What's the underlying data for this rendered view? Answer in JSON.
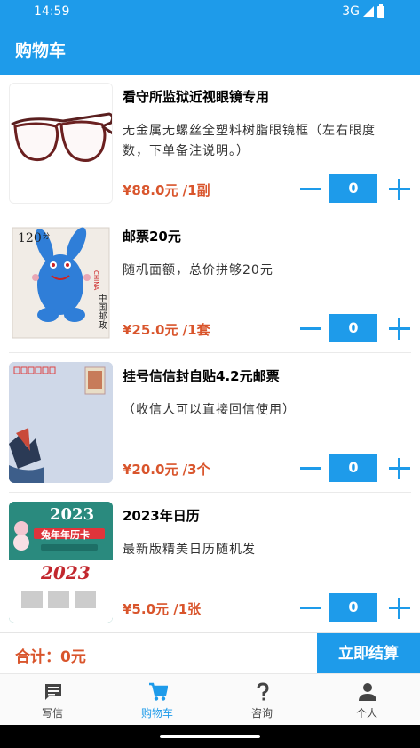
{
  "status_bar": {
    "time": "14:59",
    "network": "3G"
  },
  "app_bar": {
    "title": "购物车"
  },
  "colors": {
    "primary": "#1e9bea",
    "price": "#d9552c"
  },
  "cart_items": [
    {
      "name": "看守所监狱近视眼镜专用",
      "description": "无金属无螺丝全塑料树脂眼镜框（左右眼度数，下单备注说明。）",
      "price": "¥88.0元 /1副",
      "quantity": "0",
      "image": "glasses"
    },
    {
      "name": "邮票20元",
      "description": "随机面额，总价拼够20元",
      "price": "¥25.0元 /1套",
      "quantity": "0",
      "image": "stamp"
    },
    {
      "name": "挂号信信封自贴4.2元邮票",
      "description": "（收信人可以直接回信使用）",
      "price": "¥20.0元 /3个",
      "quantity": "0",
      "image": "envelope"
    },
    {
      "name": "2023年日历",
      "description": "最新版精美日历随机发",
      "price": "¥5.0元 /1张",
      "quantity": "0",
      "image": "calendar"
    }
  ],
  "images_text": {
    "stamp_value": "120",
    "stamp_unit": "分",
    "stamp_country": "中国邮政",
    "stamp_china": "CHINA",
    "calendar_year": "2023",
    "calendar_title": "兔年年历卡",
    "calendar_year2": "2023"
  },
  "footer": {
    "total_label": "合计：0元",
    "checkout_label": "立即结算"
  },
  "tabs": [
    {
      "label": "写信",
      "icon": "message-icon",
      "active": false
    },
    {
      "label": "购物车",
      "icon": "cart-icon",
      "active": true
    },
    {
      "label": "咨询",
      "icon": "question-icon",
      "active": false
    },
    {
      "label": "个人",
      "icon": "person-icon",
      "active": false
    }
  ]
}
